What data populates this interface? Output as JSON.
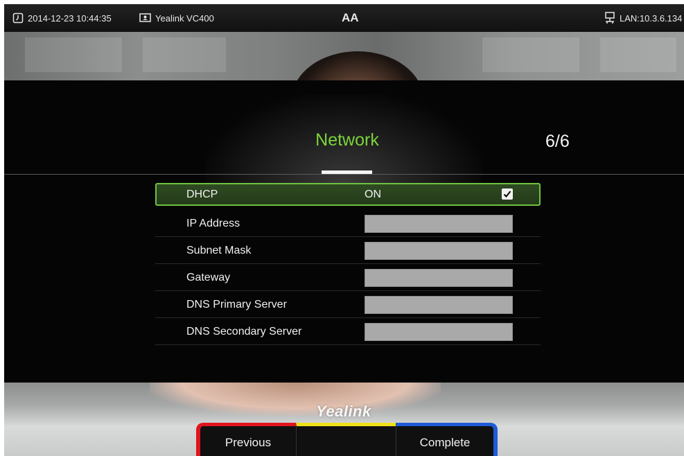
{
  "status_bar": {
    "datetime": "2014-12-23 10:44:35",
    "device": "Yealink VC400",
    "center_icon": "AA",
    "network": "LAN:10.3.6.134",
    "icons": [
      "clock-icon",
      "monitor-icon",
      "font-size-icon",
      "network-icon"
    ]
  },
  "wizard": {
    "title": "Network",
    "page": "6/6",
    "rows": [
      {
        "label": "DHCP",
        "value": "ON",
        "checked": true
      },
      {
        "label": "IP Address",
        "value": ""
      },
      {
        "label": "Subnet Mask",
        "value": ""
      },
      {
        "label": "Gateway",
        "value": ""
      },
      {
        "label": "DNS Primary Server",
        "value": ""
      },
      {
        "label": "DNS Secondary Server",
        "value": ""
      }
    ]
  },
  "brand": {
    "logo": "Yealink"
  },
  "softkeys": {
    "red": "Previous",
    "yellow": "",
    "blue": "Complete"
  },
  "colors": {
    "accent_green": "#7cd43a",
    "softkey_red": "#e0141e",
    "softkey_yellow": "#f0e01a",
    "softkey_blue": "#1f5bd6"
  }
}
